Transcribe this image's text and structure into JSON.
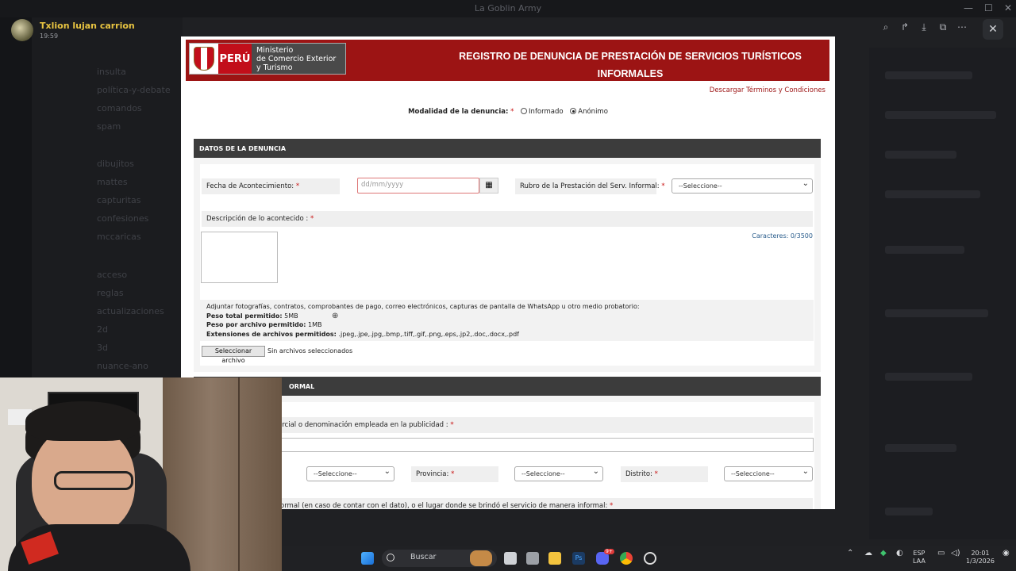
{
  "window": {
    "title": "La Goblin Army"
  },
  "viewer": {
    "user_name": "Txlion lujan carrion",
    "time": "19:59",
    "tools": [
      "zoom-icon",
      "forward-icon",
      "download-icon",
      "open-external-icon",
      "more-icon"
    ],
    "close": "✕"
  },
  "discord_channels": [
    "insulta",
    "política-y-debate",
    "comandos",
    "spam",
    "dibujitos",
    "mattes",
    "capturitas",
    "confesiones",
    "mccaricas",
    "acceso",
    "reglas",
    "actualizaciones",
    "2d",
    "3d",
    "nuance-ano"
  ],
  "form": {
    "ministry_peru": "PERÚ",
    "ministry_lines": [
      "Ministerio",
      "de Comercio Exterior",
      "y Turismo"
    ],
    "title_line1": "REGISTRO DE DENUNCIA DE PRESTACIÓN DE SERVICIOS TURÍSTICOS",
    "title_line2": "INFORMALES",
    "terms_link": "Descargar Términos y Condiciones",
    "modality_label": "Modalidad de la denuncia:",
    "modality_opt1": "Informado",
    "modality_opt2": "Anónimo",
    "section1": "DATOS DE LA DENUNCIA",
    "date_label": "Fecha de Acontecimiento:",
    "date_placeholder": "dd/mm/yyyy",
    "rubro_label": "Rubro de la Prestación del Serv. Informal:",
    "select_placeholder": "--Seleccione--",
    "desc_label": "Descripción de lo acontecido :",
    "counter": "Caracteres: 0/3500",
    "attach_line": "Adjuntar fotografías, contratos, comprobantes de pago, correo electrónicos, capturas de pantalla de WhatsApp u otro medio probatorio:",
    "peso_total_label": "Peso total permitido:",
    "peso_total": "5MB",
    "peso_archivo_label": "Peso por archivo permitido:",
    "peso_archivo": "1MB",
    "ext_label": "Extensiones de archivos permitidos:",
    "ext_value": ".jpeg,.jpe,.jpg,.bmp,.tiff,.gif,.png,.eps,.jp2,.doc,.docx,.pdf",
    "file_button": "Seleccionar archivo",
    "file_none": "Sin archivos seleccionados",
    "section2": "ORMAL",
    "name_label": "ercial o denominación empleada en la publicidad :",
    "provincia_label": "Provincia:",
    "distrito_label": "Distrito:",
    "place_label": "formal (en caso de contar con el dato), o el lugar donde se brindó el servicio de manera informal:"
  },
  "taskbar": {
    "search": "Buscar",
    "lang1": "ESP",
    "lang2": "LAA",
    "time": "20:01",
    "date": "1/3/2026",
    "discord_badge": "9+"
  },
  "colors": {
    "banner": "#9c1414",
    "accent_link": "#9c1414",
    "counter": "#2a5d8c"
  }
}
